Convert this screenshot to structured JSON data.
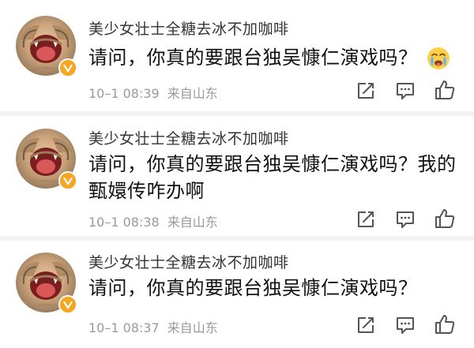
{
  "comments": [
    {
      "username": "美少女壮士全糖去冰不加咖啡",
      "text": "请问，你真的要跟台独吴慷仁演戏吗？",
      "emoji": "crying-face-emoji",
      "time": "10–1 08:39",
      "location": "来自山东"
    },
    {
      "username": "美少女壮士全糖去冰不加咖啡",
      "text": "请问，你真的要跟台独吴慷仁演戏吗？我的甄嬛传咋办啊",
      "time": "10–1 08:38",
      "location": "来自山东"
    },
    {
      "username": "美少女壮士全糖去冰不加咖啡",
      "text": "请问，你真的要跟台独吴慷仁演戏吗？",
      "time": "10–1 08:37",
      "location": "来自山东"
    }
  ],
  "icons": {
    "avatar": "screaming-cat-avatar",
    "badge": "verified-v-badge",
    "share": "share-icon",
    "comment": "comment-icon",
    "like": "thumbs-up-icon"
  },
  "colors": {
    "badge": "#f5a623",
    "meta_text": "#9a9a9a",
    "icon": "#555555",
    "separator": "#f2f2f2"
  }
}
